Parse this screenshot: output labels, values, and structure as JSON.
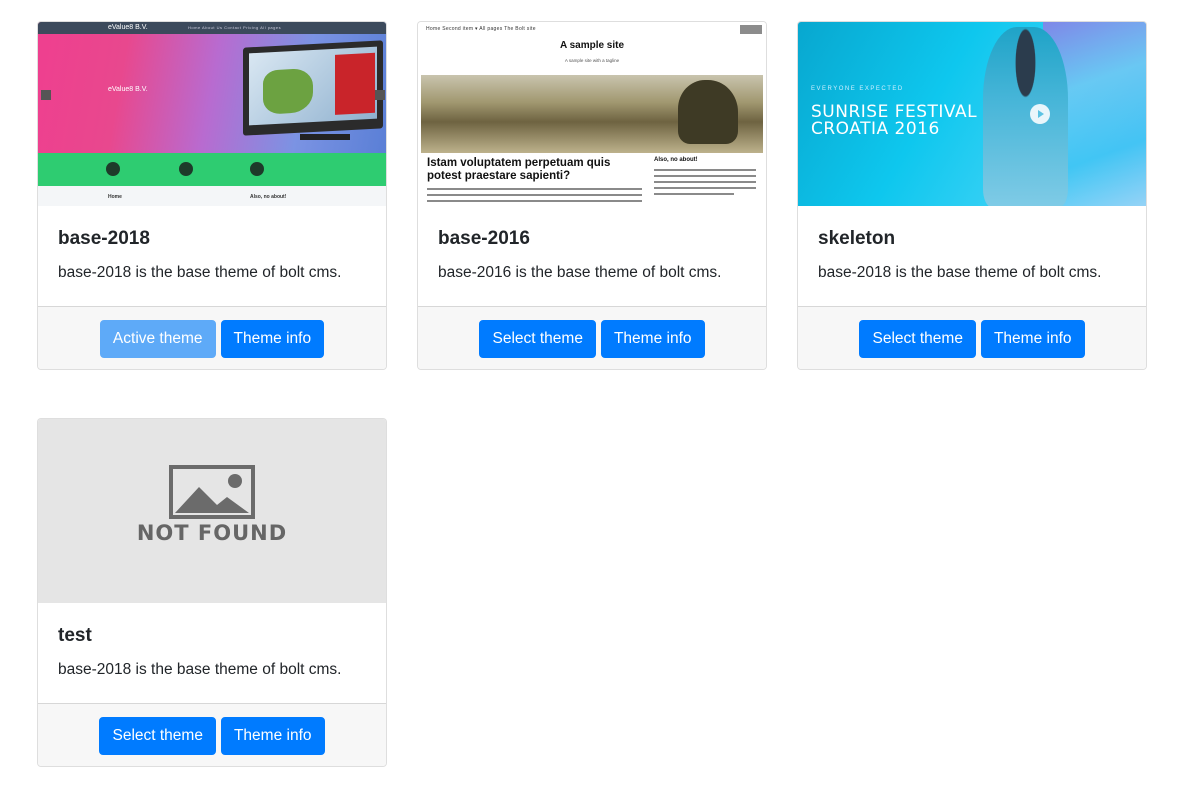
{
  "themes": [
    {
      "name": "base-2018",
      "description": "base-2018 is the base theme of bolt cms.",
      "primary_button": "Active theme",
      "primary_state": "active",
      "info_button": "Theme info",
      "preview": {
        "brand": "eValue8 B.V.",
        "nav": "Home   About Us   Contact   Pricing   All pages",
        "hero": "eValue8 B.V.",
        "section_home": "Home",
        "section_about": "Also, no about!"
      }
    },
    {
      "name": "base-2016",
      "description": "base-2016 is the base theme of bolt cms.",
      "primary_button": "Select theme",
      "primary_state": "selectable",
      "info_button": "Theme info",
      "preview": {
        "nav": "Home    Second item ▾    All pages    The Bolt site",
        "site_title": "A sample site",
        "tagline": "A sample site with a tagline",
        "heading": "Istam voluptatem perpetuam quis potest praestare sapienti?",
        "sidebar_heading": "Also, no about!"
      }
    },
    {
      "name": "skeleton",
      "description": "base-2018 is the base theme of bolt cms.",
      "primary_button": "Select theme",
      "primary_state": "selectable",
      "info_button": "Theme info",
      "preview": {
        "kicker": "EVERYONE EXPECTED",
        "title_line1": "SUNRISE FESTIVAL",
        "title_line2": "CROATIA 2016"
      }
    },
    {
      "name": "test",
      "description": "base-2018 is the base theme of bolt cms.",
      "primary_button": "Select theme",
      "primary_state": "selectable",
      "info_button": "Theme info",
      "preview": {
        "placeholder_text": "NOT FOUND"
      }
    }
  ],
  "colors": {
    "primary": "#007bff",
    "primary_disabled": "#5eaaf8",
    "footer_bg": "#f7f7f7",
    "border": "#dcdcdc"
  }
}
